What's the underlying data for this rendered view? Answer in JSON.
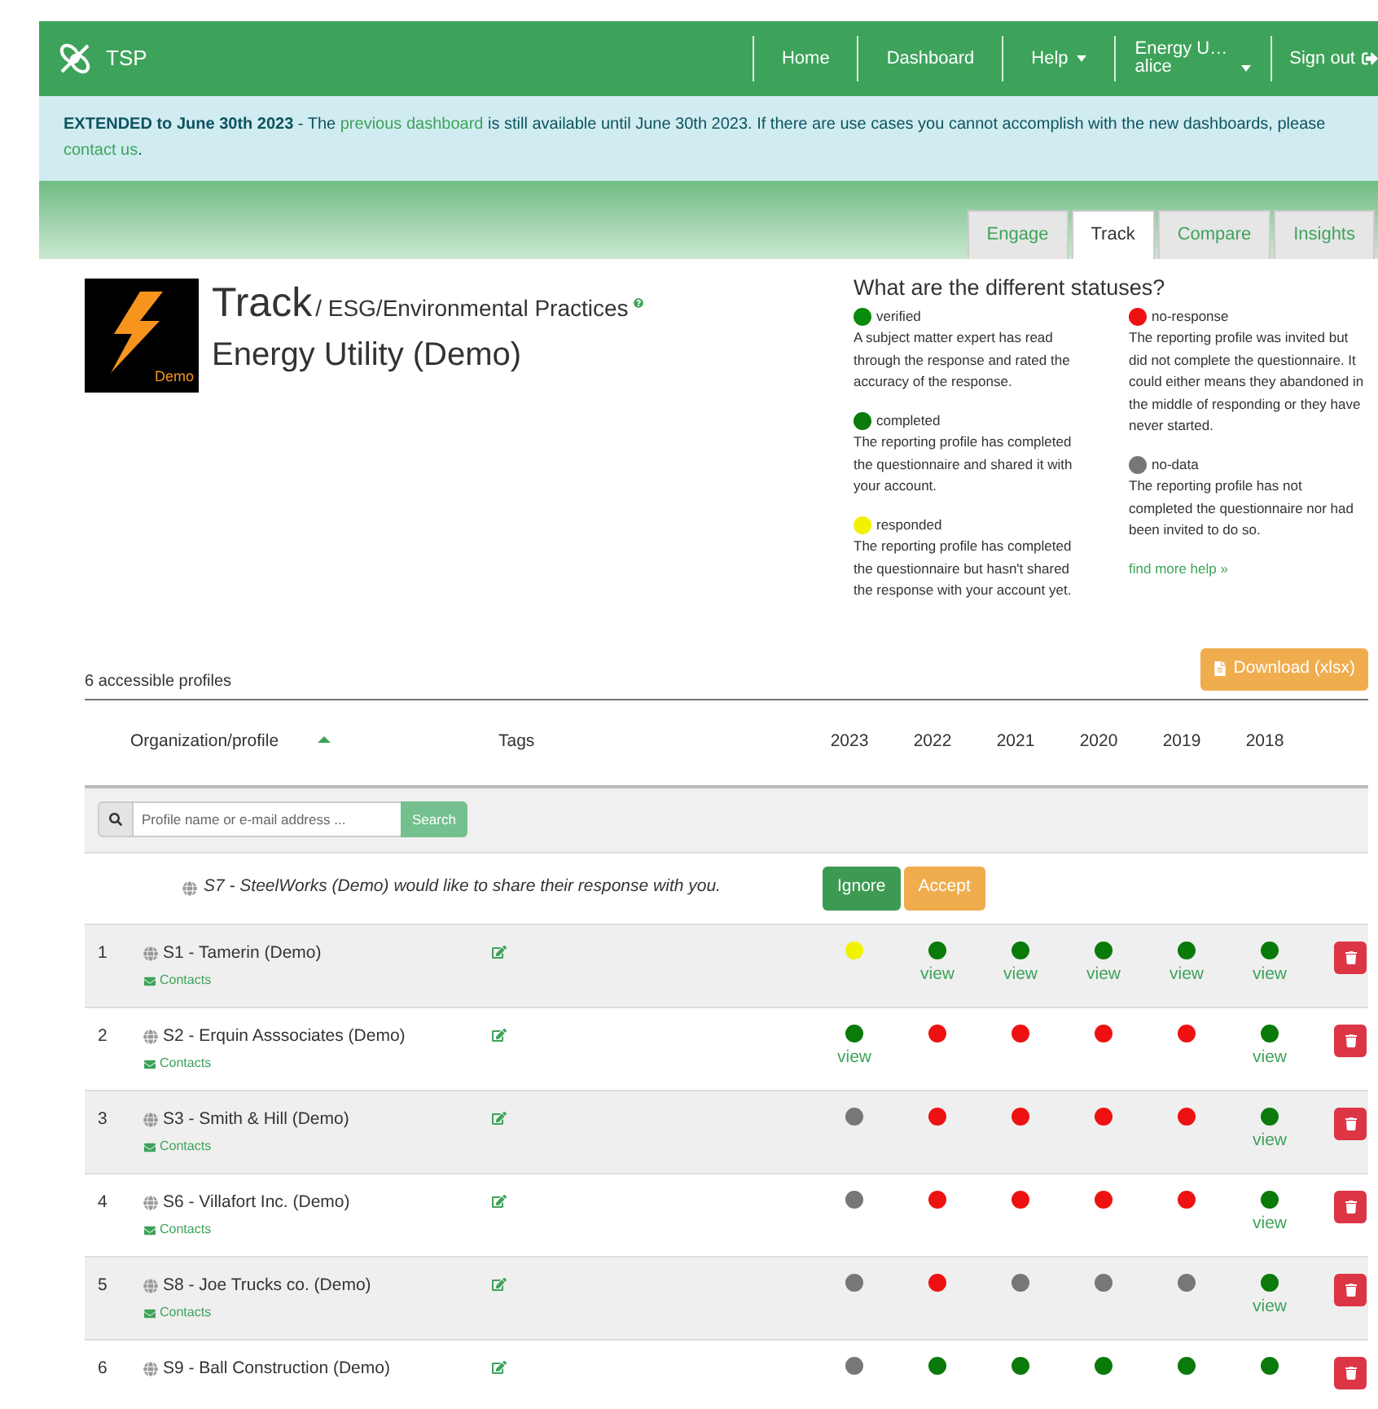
{
  "navbar": {
    "brand": "TSP",
    "items": [
      {
        "label": "Home",
        "kind": "link"
      },
      {
        "label": "Dashboard",
        "kind": "link"
      },
      {
        "label": "Help",
        "kind": "dropdown"
      }
    ],
    "account": {
      "org": "Energy U…",
      "user": "alice"
    },
    "signout": "Sign out"
  },
  "notice": {
    "bold": "EXTENDED to June 30th 2023",
    "parts": [
      " - The ",
      "previous dashboard",
      " is still available until June 30th 2023. If there are use cases you cannot accomplish with the new dashboards, please ",
      "contact us",
      "."
    ]
  },
  "tabs": [
    {
      "label": "Engage",
      "selected": false
    },
    {
      "label": "Track",
      "selected": true
    },
    {
      "label": "Compare",
      "selected": false
    },
    {
      "label": "Insights",
      "selected": false
    }
  ],
  "header": {
    "logo_text": "Demo",
    "title": "Track",
    "path": "/ ESG/Environmental Practices",
    "subtitle": "Energy Utility (Demo)"
  },
  "legend": {
    "title": "What are the different statuses?",
    "columns": [
      [
        {
          "name": "verified",
          "color": "#0a8a0a",
          "text": "A subject matter expert has read through the response and rated the accuracy of the response."
        },
        {
          "name": "completed",
          "color": "#0a7a0a",
          "text": "The reporting profile has completed the questionnaire and shared it with your account."
        },
        {
          "name": "responded",
          "color": "#f2f200",
          "text": "The reporting profile has completed the questionnaire but hasn't shared the response with your account yet."
        }
      ],
      [
        {
          "name": "no-response",
          "color": "#ee1111",
          "text": "The reporting profile was invited but did not complete the questionnaire. It could either means they abandoned in the middle of responding or they have never started."
        },
        {
          "name": "no-data",
          "color": "#777777",
          "text": "The reporting profile has not completed the questionnaire nor had been invited to do so."
        }
      ]
    ],
    "help_link": "find more help »"
  },
  "summary": "6 accessible profiles",
  "download": "Download (xlsx)",
  "table": {
    "organization_heading": "Organization/profile",
    "tags_heading": "Tags",
    "years": [
      "2023",
      "2022",
      "2021",
      "2020",
      "2019",
      "2018"
    ],
    "sorted_ascending": true,
    "search": {
      "placeholder": "Profile name or e-mail address ...",
      "button": "Search"
    },
    "request": {
      "text": "S7 - SteelWorks (Demo) would like to share their response with you.",
      "ignore": "Ignore",
      "accept": "Accept"
    },
    "rows": [
      {
        "index": "1",
        "name": "S1 - Tamerin (Demo)",
        "contacts": "Contacts",
        "cells": [
          {
            "color": "#f2f200"
          },
          {
            "color": "#0a7a0a",
            "link": "view"
          },
          {
            "color": "#0a7a0a",
            "link": "view"
          },
          {
            "color": "#0a7a0a",
            "link": "view"
          },
          {
            "color": "#0a7a0a",
            "link": "view"
          },
          {
            "color": "#0a7a0a",
            "link": "view"
          }
        ]
      },
      {
        "index": "2",
        "name": "S2 - Erquin Asssociates (Demo)",
        "contacts": "Contacts",
        "cells": [
          {
            "color": "#0a7a0a",
            "link": "view"
          },
          {
            "color": "#ee1111"
          },
          {
            "color": "#ee1111"
          },
          {
            "color": "#ee1111"
          },
          {
            "color": "#ee1111"
          },
          {
            "color": "#0a7a0a",
            "link": "view"
          }
        ]
      },
      {
        "index": "3",
        "name": "S3 - Smith & Hill (Demo)",
        "contacts": "Contacts",
        "cells": [
          {
            "color": "#777777"
          },
          {
            "color": "#ee1111"
          },
          {
            "color": "#ee1111"
          },
          {
            "color": "#ee1111"
          },
          {
            "color": "#ee1111"
          },
          {
            "color": "#0a7a0a",
            "link": "view"
          }
        ]
      },
      {
        "index": "4",
        "name": "S6 - Villafort Inc. (Demo)",
        "contacts": "Contacts",
        "cells": [
          {
            "color": "#777777"
          },
          {
            "color": "#ee1111"
          },
          {
            "color": "#ee1111"
          },
          {
            "color": "#ee1111"
          },
          {
            "color": "#ee1111"
          },
          {
            "color": "#0a7a0a",
            "link": "view"
          }
        ]
      },
      {
        "index": "5",
        "name": "S8 - Joe Trucks co. (Demo)",
        "contacts": "Contacts",
        "cells": [
          {
            "color": "#777777"
          },
          {
            "color": "#ee1111"
          },
          {
            "color": "#777777"
          },
          {
            "color": "#777777"
          },
          {
            "color": "#777777"
          },
          {
            "color": "#0a7a0a",
            "link": "view"
          }
        ]
      },
      {
        "index": "6",
        "name": "S9 - Ball Construction (Demo)",
        "cells": [
          {
            "color": "#777777"
          },
          {
            "color": "#0a7a0a"
          },
          {
            "color": "#0a7a0a"
          },
          {
            "color": "#0a7a0a"
          },
          {
            "color": "#0a7a0a"
          },
          {
            "color": "#0a7a0a"
          }
        ]
      }
    ]
  }
}
